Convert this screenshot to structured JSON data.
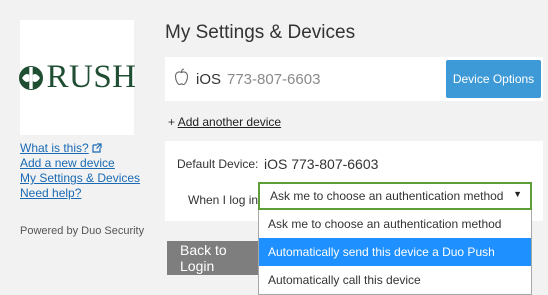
{
  "sidebar": {
    "logo_text": "RUSH",
    "links": [
      "What is this?",
      "Add a new device",
      "My Settings & Devices",
      "Need help?"
    ],
    "powered_by": "Powered by Duo Security"
  },
  "main": {
    "title": "My Settings & Devices",
    "device": {
      "os": "iOS",
      "phone": "773-807-6603",
      "options_label": "Device Options",
      "icon": "apple-icon"
    },
    "add_another_prefix": "+ ",
    "add_another_label": "Add another device",
    "default_device_label": "Default Device:",
    "default_device_value": "iOS 773-807-6603",
    "when_login_label": "When I log in:",
    "when_login_selected": "Ask me to choose an authentication method",
    "back_label": "Back to Login",
    "dropdown_options": [
      "Ask me to choose an authentication method",
      "Automatically send this device a Duo Push",
      "Automatically call this device"
    ],
    "highlighted_option": 1
  },
  "colors": {
    "brand_green": "#1f4e33",
    "accent_blue": "#3e9ad6",
    "highlight": "#1e90ff",
    "focus_green": "#5c9e37"
  }
}
